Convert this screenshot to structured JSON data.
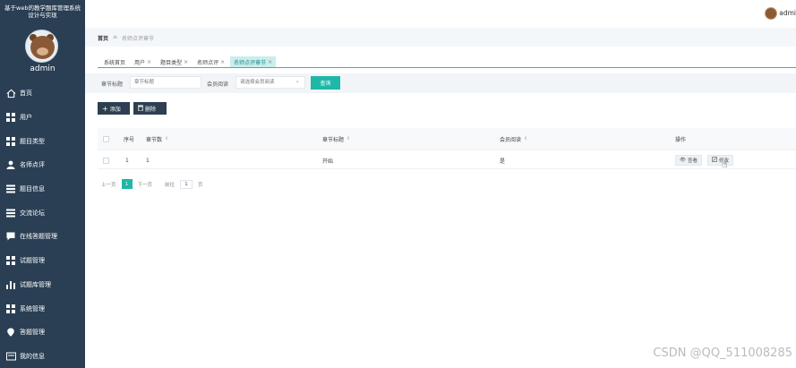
{
  "sidebar": {
    "system_title_line1": "基于web的教学题库管理系统",
    "system_title_line2": "设计与实现",
    "username": "admin",
    "items": [
      {
        "label": "首页",
        "icon": "home-icon"
      },
      {
        "label": "用户",
        "icon": "grid-icon"
      },
      {
        "label": "题目类型",
        "icon": "grid-icon"
      },
      {
        "label": "名师点评",
        "icon": "user-icon"
      },
      {
        "label": "题目信息",
        "icon": "list-icon"
      },
      {
        "label": "交流论坛",
        "icon": "list-icon"
      },
      {
        "label": "在线答题管理",
        "icon": "chat-icon"
      },
      {
        "label": "试题管理",
        "icon": "grid-icon"
      },
      {
        "label": "试题库管理",
        "icon": "bar-chart-icon"
      },
      {
        "label": "系统管理",
        "icon": "grid-icon"
      },
      {
        "label": "答题管理",
        "icon": "location-icon"
      },
      {
        "label": "我的信息",
        "icon": "card-icon"
      }
    ]
  },
  "header": {
    "user_short": "admi"
  },
  "breadcrumb": {
    "home": "首页",
    "separator": "≡",
    "current": "名师点评章节"
  },
  "tabs": [
    {
      "label": "系统首页",
      "closable": false,
      "active": false
    },
    {
      "label": "用户",
      "closable": true,
      "active": false
    },
    {
      "label": "题目类型",
      "closable": true,
      "active": false
    },
    {
      "label": "名师点评",
      "closable": true,
      "active": false
    },
    {
      "label": "名师点评章节",
      "closable": true,
      "active": true
    }
  ],
  "tab_close_symbol": "×",
  "search": {
    "chapter_title_label": "章节标题",
    "chapter_title_placeholder": "章节标题",
    "member_read_label": "会员阅读",
    "member_read_placeholder": "请选择会员阅读",
    "query_button": "查询"
  },
  "actions": {
    "add_button": "添加",
    "delete_button": "删除"
  },
  "table": {
    "columns": [
      "序号",
      "章节数",
      "章节标题",
      "会员阅读",
      "操作"
    ],
    "rows": [
      {
        "index": "1",
        "chapter_num": "1",
        "chapter_title": "开始",
        "member_read": "是",
        "view": "查看",
        "edit": "修改"
      }
    ]
  },
  "pagination": {
    "prev": "上一页",
    "current": "1",
    "next": "下一页",
    "goto_label": "前往",
    "goto_value": "1",
    "page_unit": "页"
  },
  "watermark": "CSDN @QQ_511008285",
  "colors": {
    "sidebar": "#2a3f54",
    "accent": "#1fb7a8",
    "dark_button": "#2d3f50"
  }
}
